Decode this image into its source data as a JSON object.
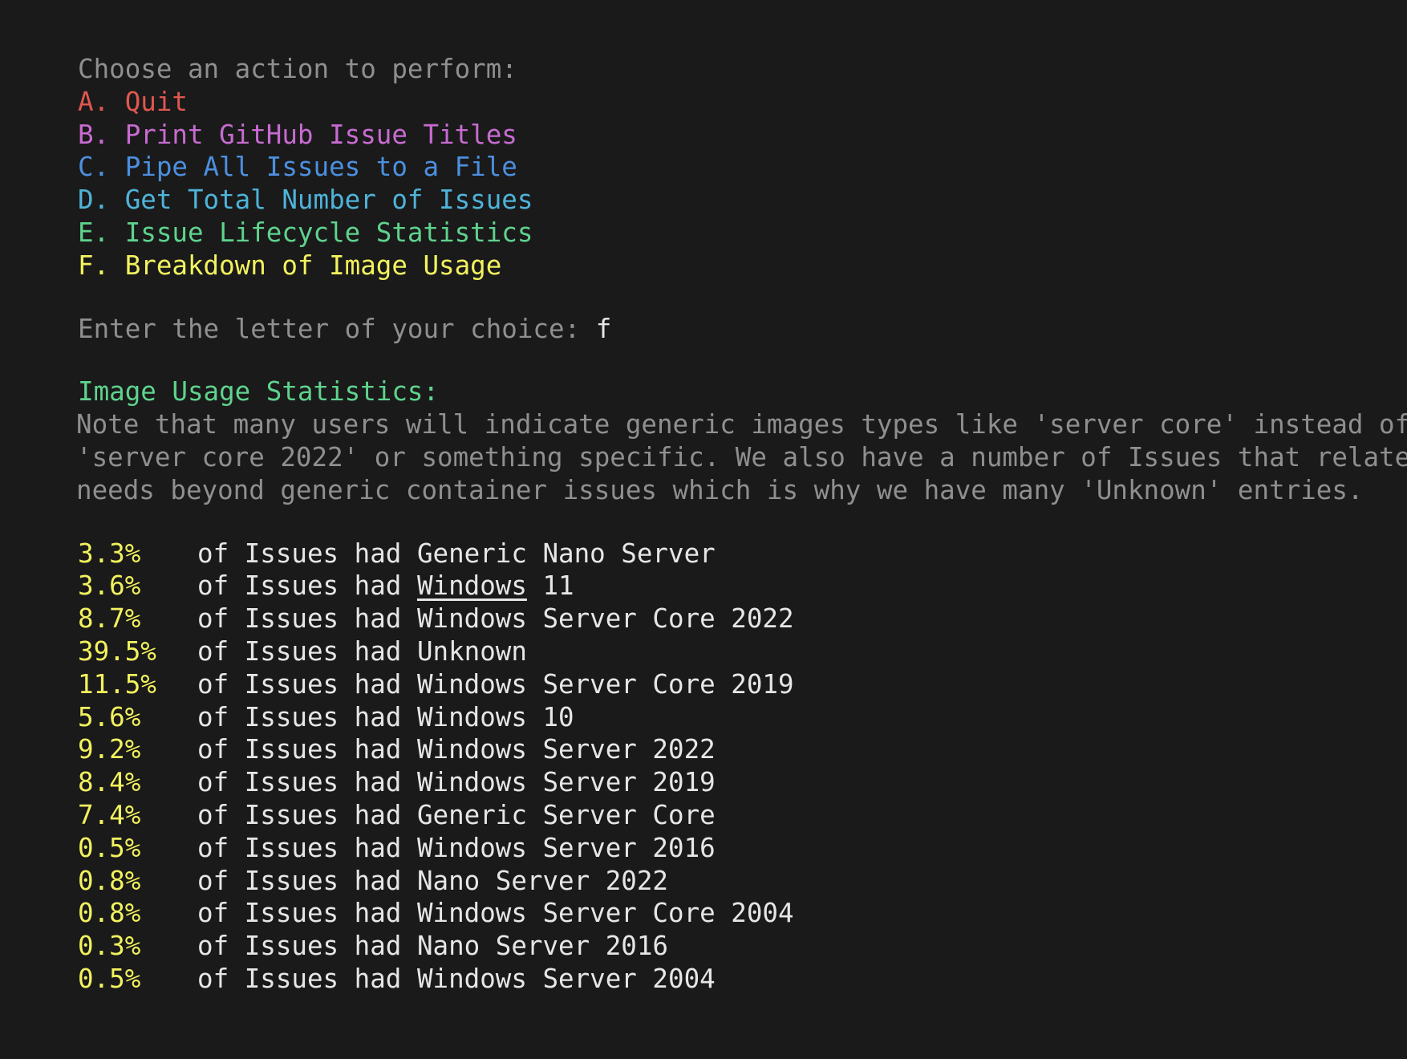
{
  "menu": {
    "prompt": "Choose an action to perform:",
    "options": [
      {
        "label": "A. Quit",
        "color": "#e0574f"
      },
      {
        "label": "B. Print GitHub Issue Titles",
        "color": "#c86bd1"
      },
      {
        "label": "C. Pipe All Issues to a File",
        "color": "#4c8fe0"
      },
      {
        "label": "D. Get Total Number of Issues",
        "color": "#4fb3d9"
      },
      {
        "label": "E. Issue Lifecycle Statistics",
        "color": "#5fd38d"
      },
      {
        "label": "F. Breakdown of Image Usage",
        "color": "#f2f25f"
      }
    ]
  },
  "choice": {
    "prompt": "Enter the letter of your choice: ",
    "value": "f"
  },
  "stats": {
    "heading": "Image Usage Statistics:",
    "note_lines": [
      "Note that many users will indicate generic images types like 'server core' instead of",
      "'server core 2022' or something specific. We also have a number of Issues that relate",
      "needs beyond generic container issues which is why we have many 'Unknown' entries."
    ],
    "prefix": "of Issues had ",
    "rows": [
      {
        "percent": "3.3%",
        "image": "Generic Nano Server"
      },
      {
        "percent": "3.6%",
        "image_underlined": "Windows",
        "image_rest": " 11"
      },
      {
        "percent": "8.7%",
        "image": "Windows Server Core 2022"
      },
      {
        "percent": "39.5%",
        "image": "Unknown"
      },
      {
        "percent": "11.5%",
        "image": "Windows Server Core 2019"
      },
      {
        "percent": "5.6%",
        "image": "Windows 10"
      },
      {
        "percent": "9.2%",
        "image": "Windows Server 2022"
      },
      {
        "percent": "8.4%",
        "image": "Windows Server 2019"
      },
      {
        "percent": "7.4%",
        "image": "Generic Server Core"
      },
      {
        "percent": "0.5%",
        "image": "Windows Server 2016"
      },
      {
        "percent": "0.8%",
        "image": "Nano Server 2022"
      },
      {
        "percent": "0.8%",
        "image": "Windows Server Core 2004"
      },
      {
        "percent": "0.3%",
        "image": "Nano Server 2016"
      },
      {
        "percent": "0.5%",
        "image": "Windows Server 2004"
      }
    ]
  }
}
